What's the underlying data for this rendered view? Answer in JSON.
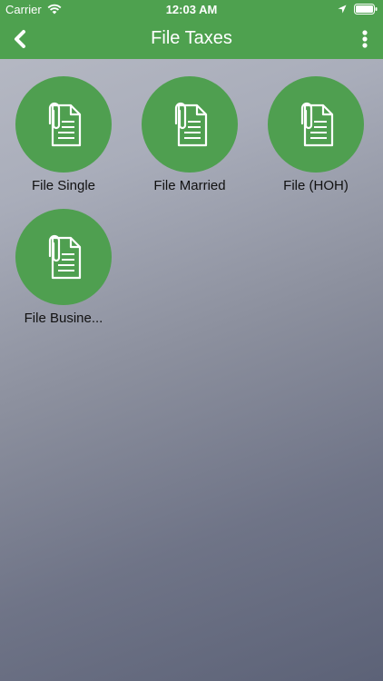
{
  "status_bar": {
    "carrier": "Carrier",
    "time": "12:03 AM"
  },
  "nav": {
    "title": "File Taxes"
  },
  "tiles": [
    {
      "label": "File Single",
      "icon": "document-paperclip-icon"
    },
    {
      "label": "File Married",
      "icon": "document-paperclip-icon"
    },
    {
      "label": "File (HOH)",
      "icon": "document-paperclip-icon"
    },
    {
      "label": "File Busine...",
      "icon": "document-paperclip-icon"
    }
  ],
  "colors": {
    "accent": "#4ea14f",
    "tile": "#4f9f50"
  }
}
